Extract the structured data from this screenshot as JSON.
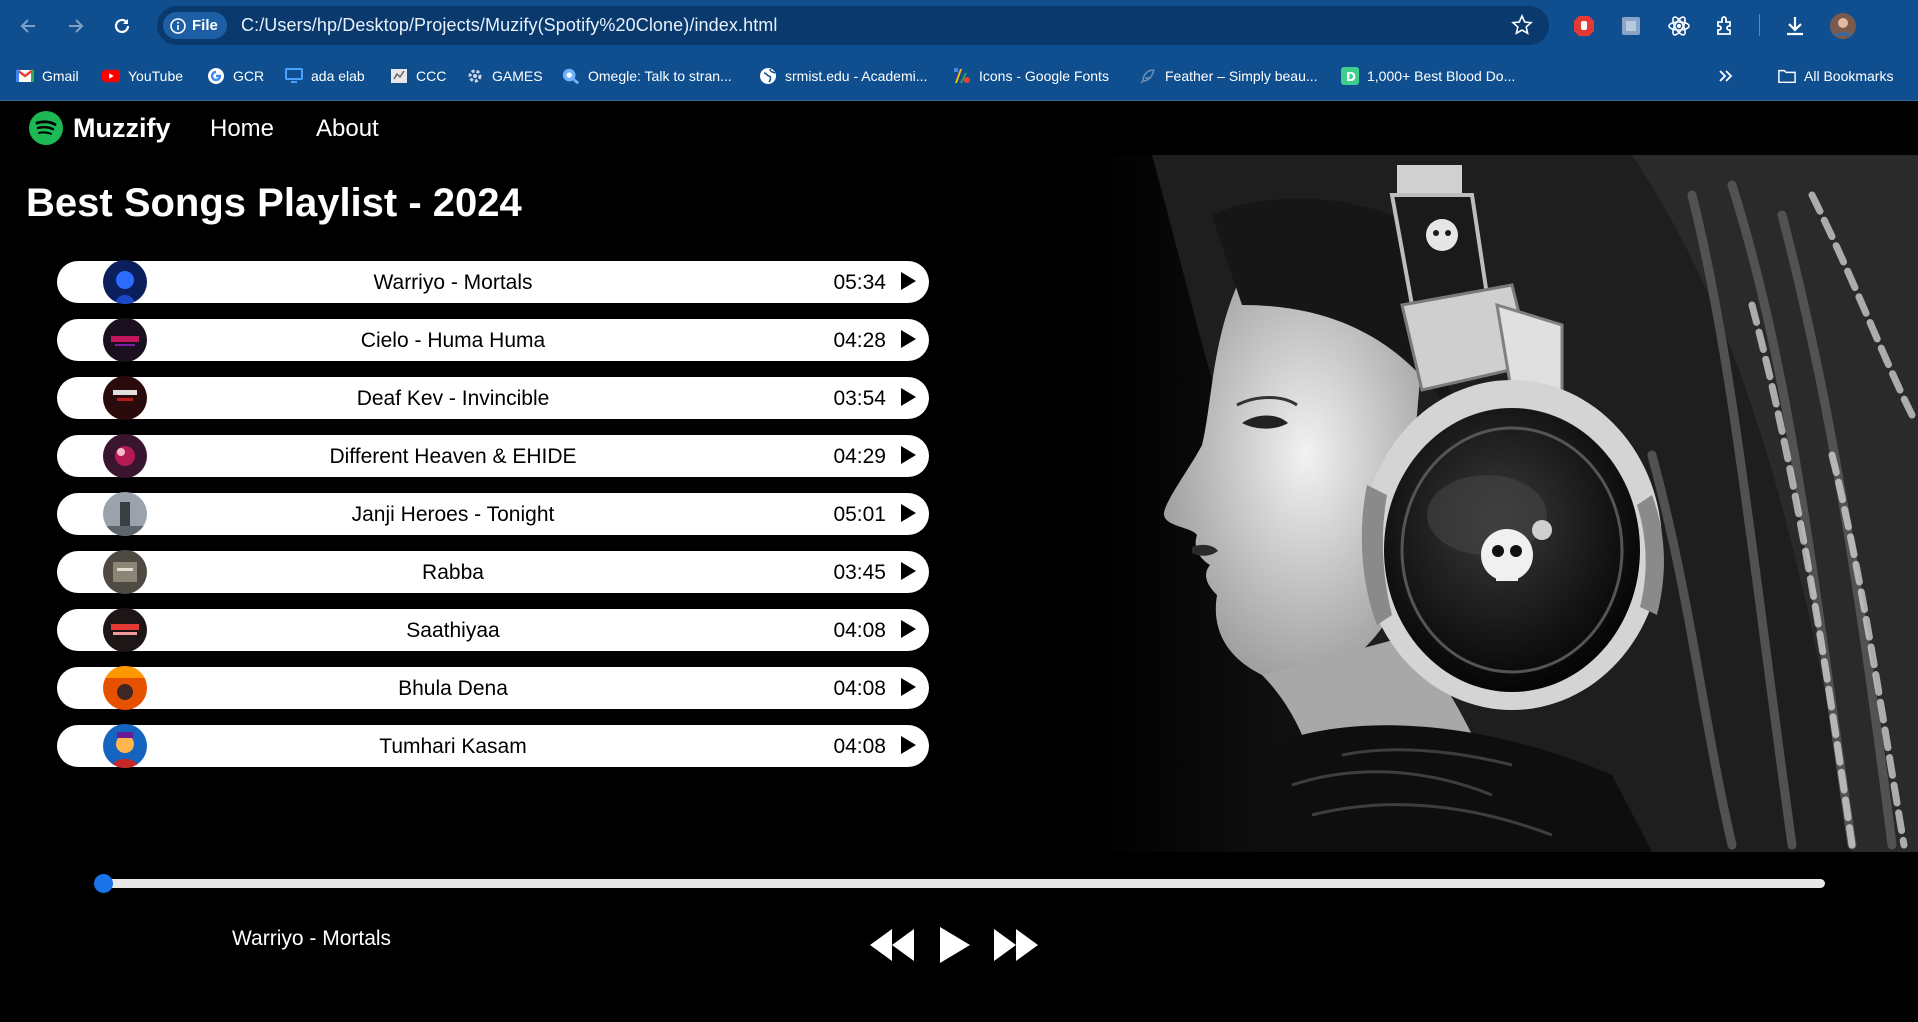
{
  "browser": {
    "site_chip": "File",
    "url": "C:/Users/hp/Desktop/Projects/Muzify(Spotify%20Clone)/index.html",
    "bookmarks": [
      {
        "label": "Gmail",
        "icon": "gmail-icon"
      },
      {
        "label": "YouTube",
        "icon": "youtube-icon"
      },
      {
        "label": "GCR",
        "icon": "google-icon"
      },
      {
        "label": "ada elab",
        "icon": "monitor-icon"
      },
      {
        "label": "CCC",
        "icon": "ccc-icon"
      },
      {
        "label": "GAMES",
        "icon": "gear-icon"
      },
      {
        "label": "Omegle: Talk to stran...",
        "icon": "omegle-icon"
      },
      {
        "label": "srmist.edu - Academi...",
        "icon": "globe-icon"
      },
      {
        "label": "Icons - Google Fonts",
        "icon": "google-fonts-icon"
      },
      {
        "label": "Feather – Simply beau...",
        "icon": "feather-icon"
      },
      {
        "label": "1,000+ Best Blood Do...",
        "icon": "d-icon"
      }
    ],
    "all_bookmarks": "All Bookmarks"
  },
  "app": {
    "logo": "Muzzify",
    "nav": {
      "home": "Home",
      "about": "About"
    },
    "playlist_title": "Best Songs Playlist - 2024",
    "songs": [
      {
        "name": "Warriyo - Mortals",
        "time": "05:34"
      },
      {
        "name": "Cielo - Huma Huma",
        "time": "04:28"
      },
      {
        "name": "Deaf Kev - Invincible",
        "time": "03:54"
      },
      {
        "name": "Different Heaven & EHIDE",
        "time": "04:29"
      },
      {
        "name": "Janji Heroes - Tonight",
        "time": "05:01"
      },
      {
        "name": "Rabba",
        "time": "03:45"
      },
      {
        "name": "Saathiyaa",
        "time": "04:08"
      },
      {
        "name": "Bhula Dena",
        "time": "04:08"
      },
      {
        "name": "Tumhari Kasam",
        "time": "04:08"
      }
    ],
    "progress": 0,
    "now_playing": "Warriyo - Mortals"
  },
  "colors": {
    "chrome": "#0f4f8f",
    "accent": "#1a73e8",
    "spotify_green": "#1db954"
  }
}
